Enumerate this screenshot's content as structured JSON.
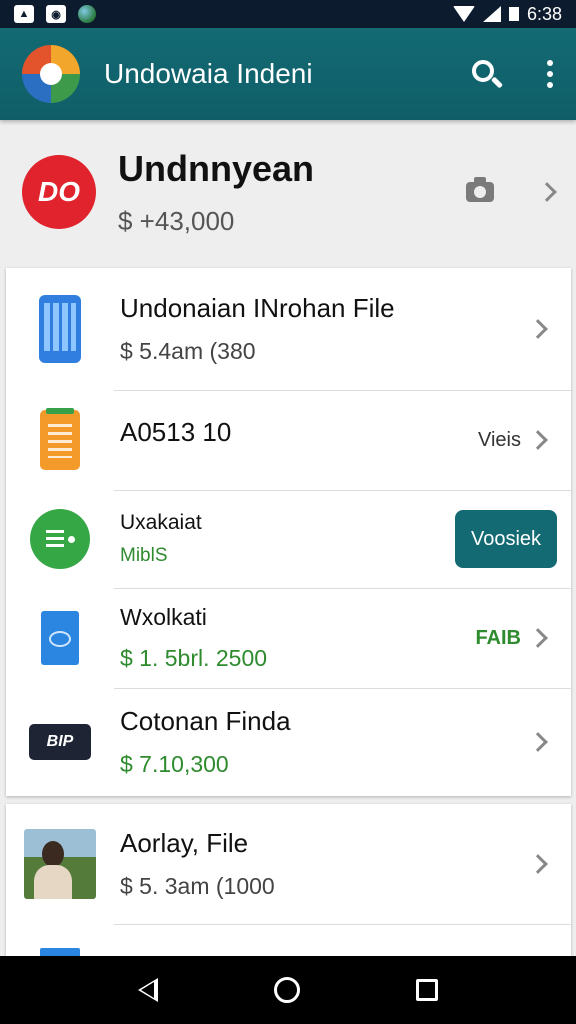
{
  "status_bar": {
    "time": "6:38",
    "notification_icons": [
      "image-icon",
      "eye-icon",
      "globe-icon"
    ]
  },
  "app_bar": {
    "title": "Undowaia Indeni",
    "icons": [
      "app-logo-icon",
      "search-icon",
      "more-vert-icon"
    ]
  },
  "profile": {
    "badge": "DO",
    "name": "Undnnyean",
    "amount": "$ +43,000"
  },
  "card1": {
    "rows": [
      {
        "title": "Undonaian INrohan File",
        "sub": "$ 5.4am (380",
        "icon": "phone-icon"
      },
      {
        "title": "A0513 10",
        "badge": "Vieis",
        "icon": "notes-icon"
      },
      {
        "title": "Uxakaiat",
        "sub": "MiblS",
        "action": "Voosiek",
        "icon": "chat-icon"
      },
      {
        "title": "Wxolkati",
        "sub": "$ 1. 5brl. 2500",
        "badge": "FAIB",
        "icon": "card-icon"
      },
      {
        "title": "Cotonan Finda",
        "sub": "$ 7.10,300",
        "bank_label": "BIP",
        "icon": "bank-icon"
      }
    ]
  },
  "card2": {
    "rows": [
      {
        "title": "Aorlay, File",
        "sub": "$ 5. 3am (1000",
        "icon": "photo-icon"
      }
    ]
  },
  "colors": {
    "primary": "#136a73",
    "status_bar": "#0d1b2e",
    "accent_red": "#e1232d",
    "money_green": "#2e8b2e"
  }
}
